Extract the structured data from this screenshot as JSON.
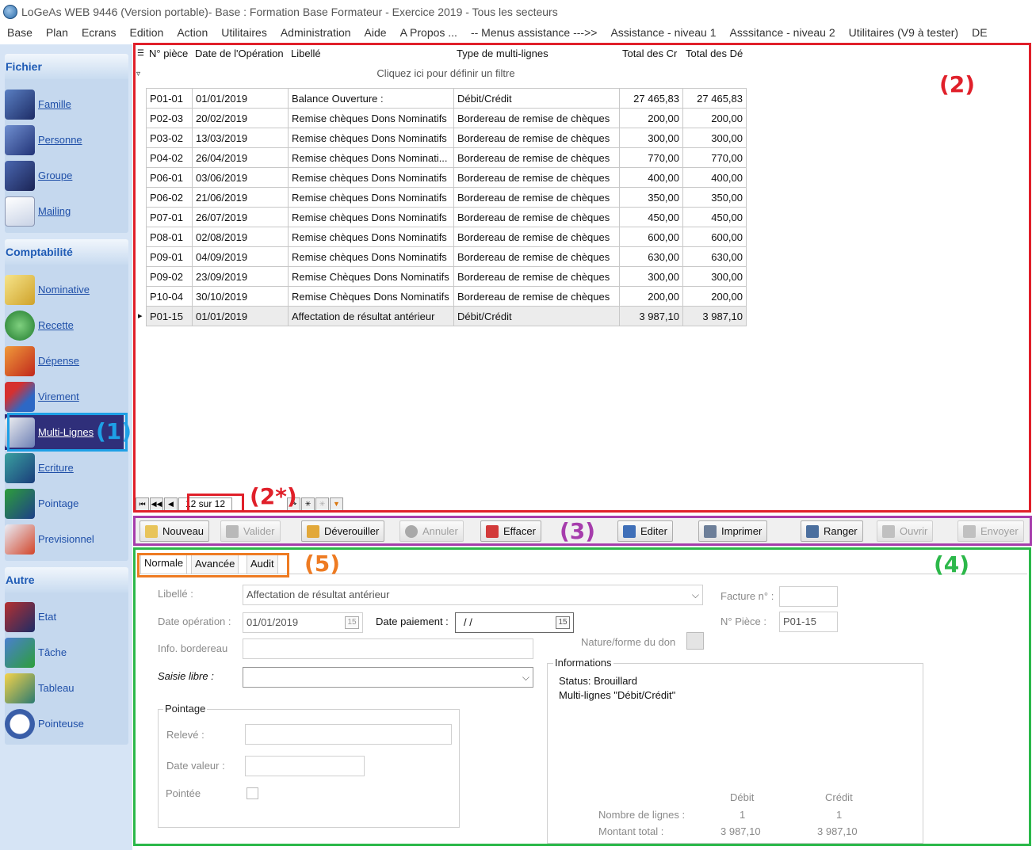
{
  "window": {
    "title": "LoGeAs WEB 9446 (Version portable)- Base : Formation Base Formateur - Exercice 2019 - Tous les secteurs"
  },
  "menu": [
    "Base",
    "Plan",
    "Ecrans",
    "Edition",
    "Action",
    "Utilitaires",
    "Administration",
    "Aide",
    "A Propos ...",
    "-- Menus assistance --->>",
    "Assistance - niveau 1",
    "Asssitance - niveau 2",
    "Utilitaires  (V9 à tester)",
    "DE"
  ],
  "sidebar": {
    "groups": [
      {
        "title": "Fichier",
        "items": [
          {
            "label": "Famille",
            "icon": "family-icon"
          },
          {
            "label": "Personne",
            "icon": "person-icon"
          },
          {
            "label": "Groupe",
            "icon": "group-icon"
          },
          {
            "label": "Mailing",
            "icon": "envelope-icon"
          }
        ]
      },
      {
        "title": "Comptabilité",
        "items": [
          {
            "label": "Nominative",
            "icon": "clipboard-icon"
          },
          {
            "label": "Recette",
            "icon": "income-icon"
          },
          {
            "label": "Dépense",
            "icon": "expense-icon"
          },
          {
            "label": "Virement",
            "icon": "transfer-icon"
          },
          {
            "label": "Multi-Lignes",
            "icon": "multilines-icon",
            "selected": true
          },
          {
            "label": "Ecriture",
            "icon": "entry-icon"
          },
          {
            "label": "Pointage",
            "icon": "checklist-icon"
          },
          {
            "label": "Previsionnel",
            "icon": "calendar-clock-icon"
          }
        ]
      },
      {
        "title": "Autre",
        "items": [
          {
            "label": "Etat",
            "icon": "report-icon"
          },
          {
            "label": "Tâche",
            "icon": "task-icon"
          },
          {
            "label": "Tableau",
            "icon": "folder-table-icon"
          },
          {
            "label": "Pointeuse",
            "icon": "clock-icon"
          }
        ]
      }
    ]
  },
  "grid": {
    "columns": [
      "N° pièce",
      "Date de l'Opération",
      "Libellé",
      "Type de multi-lignes",
      "Total des Cr",
      "Total des Dé"
    ],
    "filter_hint": "Cliquez ici pour définir un filtre",
    "rows": [
      [
        "P01-01",
        "01/01/2019",
        "Balance Ouverture :",
        "Débit/Crédit",
        "27 465,83",
        "27 465,83"
      ],
      [
        "P02-03",
        "20/02/2019",
        "Remise chèques Dons Nominatifs",
        "Bordereau de remise de chèques",
        "200,00",
        "200,00"
      ],
      [
        "P03-02",
        "13/03/2019",
        "Remise chèques Dons Nominatifs",
        "Bordereau de remise de chèques",
        "300,00",
        "300,00"
      ],
      [
        "P04-02",
        "26/04/2019",
        "Remise chèques Dons Nominati...",
        "Bordereau de remise de chèques",
        "770,00",
        "770,00"
      ],
      [
        "P06-01",
        "03/06/2019",
        "Remise chèques Dons Nominatifs",
        "Bordereau de remise de chèques",
        "400,00",
        "400,00"
      ],
      [
        "P06-02",
        "21/06/2019",
        "Remise chèques Dons Nominatifs",
        "Bordereau de remise de chèques",
        "350,00",
        "350,00"
      ],
      [
        "P07-01",
        "26/07/2019",
        "Remise chèques Dons Nominatifs",
        "Bordereau de remise de chèques",
        "450,00",
        "450,00"
      ],
      [
        "P08-01",
        "02/08/2019",
        "Remise chèques Dons Nominatifs",
        "Bordereau de remise de chèques",
        "600,00",
        "600,00"
      ],
      [
        "P09-01",
        "04/09/2019",
        "Remise chèques Dons Nominatifs",
        "Bordereau de remise de chèques",
        "630,00",
        "630,00"
      ],
      [
        "P09-02",
        "23/09/2019",
        "Remise Chèques Dons Nominatifs",
        "Bordereau de remise de chèques",
        "300,00",
        "300,00"
      ],
      [
        "P10-04",
        "30/10/2019",
        "Remise Chèques Dons Nominatifs",
        "Bordereau de remise de chèques",
        "200,00",
        "200,00"
      ],
      [
        "P01-15",
        "01/01/2019",
        "Affectation de résultat antérieur",
        "Débit/Crédit",
        "3 987,10",
        "3 987,10"
      ]
    ],
    "current_row_index": 11,
    "record_counter": "12 sur 12"
  },
  "toolbar": {
    "buttons": [
      {
        "label": "Nouveau",
        "enabled": true,
        "icon": "new-icon"
      },
      {
        "label": "Valider",
        "enabled": false,
        "icon": "save-icon"
      },
      {
        "label": "Déverouiller",
        "enabled": true,
        "icon": "unlock-icon"
      },
      {
        "label": "Annuler",
        "enabled": false,
        "icon": "cancel-icon"
      },
      {
        "label": "Effacer",
        "enabled": true,
        "icon": "delete-icon"
      },
      {
        "label": "Editer",
        "enabled": true,
        "icon": "pencil-icon"
      },
      {
        "label": "Imprimer",
        "enabled": true,
        "icon": "printer-icon"
      },
      {
        "label": "Ranger",
        "enabled": true,
        "icon": "store-icon"
      },
      {
        "label": "Ouvrir",
        "enabled": false,
        "icon": "open-icon"
      },
      {
        "label": "Envoyer",
        "enabled": false,
        "icon": "send-icon"
      }
    ]
  },
  "form": {
    "tabs": [
      "Normale",
      "Avancée",
      "Audit"
    ],
    "active_tab": "Normale",
    "libelle_label": "Libellé :",
    "libelle_value": "Affectation de résultat antérieur",
    "date_operation_label": "Date opération :",
    "date_operation_value": "01/01/2019",
    "date_paiement_label": "Date paiement :",
    "date_paiement_value": "/ /",
    "info_bordereau_label": "Info. bordereau",
    "saisie_libre_label": "Saisie libre :",
    "facture_label": "Facture n° :",
    "piece_label": "N° Pièce :",
    "piece_value": "P01-15",
    "nature_label": "Nature/forme du don",
    "pointage_title": "Pointage",
    "releve_label": "Relevé :",
    "date_valeur_label": "Date valeur :",
    "pointee_label": "Pointée",
    "info_title": "Informations",
    "info_status": "Status: Brouillard",
    "info_type": "Multi-lignes \"Débit/Crédit\"",
    "debit_header": "Débit",
    "credit_header": "Crédit",
    "nb_lignes_label": "Nombre de lignes :",
    "nb_lignes_debit": "1",
    "nb_lignes_credit": "1",
    "montant_label": "Montant total :",
    "montant_debit": "3 987,10",
    "montant_credit": "3 987,10"
  },
  "annotations": {
    "sidebar": "(1)",
    "grid": "(2)",
    "counter": "(2*)",
    "toolbar": "(3)",
    "form": "(4)",
    "tabs": "(5)",
    "colors": {
      "sidebar": "#1ea0e6",
      "grid": "#e0202a",
      "toolbar": "#a63dac",
      "form": "#2cb84a",
      "tabs": "#ee7b22"
    }
  },
  "colors": {
    "sidebar_bg": "#d6e4f5",
    "sidebar_title": "#1f5bb5",
    "selected_item": "#2f2f7a"
  }
}
